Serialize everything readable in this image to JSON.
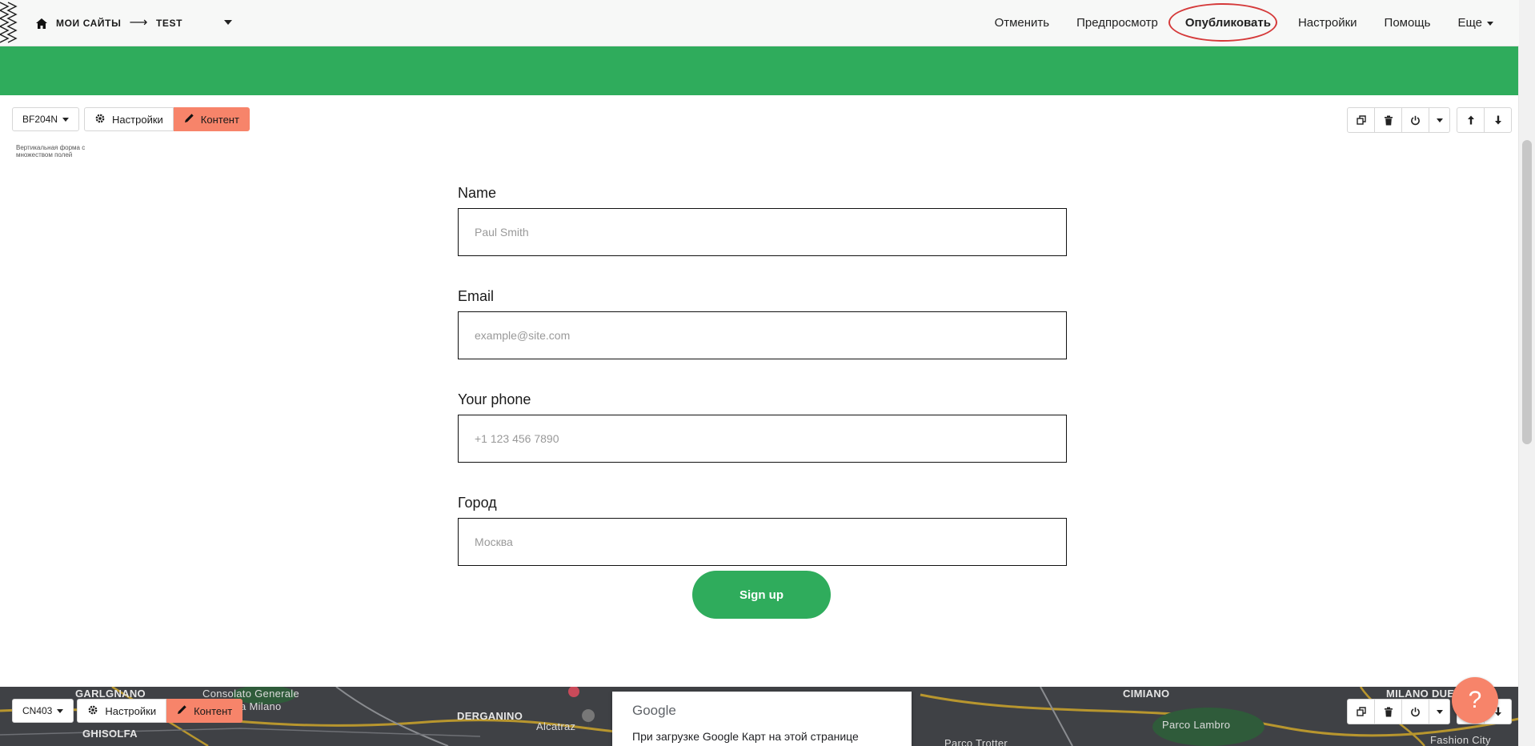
{
  "topbar": {
    "home_icon": "home-icon",
    "site_label": "МОИ САЙТЫ",
    "arrow": "⟶",
    "page_label": "TEST",
    "nav": [
      "Отменить",
      "Предпросмотр",
      "Опубликовать",
      "Настройки",
      "Помощь",
      "Еще"
    ]
  },
  "block1": {
    "id_label": "BF204N",
    "settings_label": "Настройки",
    "content_label": "Контент",
    "description": "Вертикальная форма с множеством полей",
    "tools": [
      "duplicate-icon",
      "trash-icon",
      "power-icon",
      "caret-down-icon",
      "arrow-up-icon",
      "arrow-down-icon"
    ]
  },
  "form": {
    "fields": [
      {
        "label": "Name",
        "placeholder": "Paul Smith"
      },
      {
        "label": "Email",
        "placeholder": "example@site.com"
      },
      {
        "label": "Your phone",
        "placeholder": "+1 123 456 7890"
      },
      {
        "label": "Город",
        "placeholder": "Москва"
      }
    ],
    "submit_label": "Sign up"
  },
  "block2": {
    "id_label": "CN403",
    "settings_label": "Настройки",
    "content_label": "Контент"
  },
  "map": {
    "labels": [
      "GARLGNANO",
      "Consolato Generale",
      "a Milano",
      "GHISOLFA",
      "DERGANINO",
      "Alcatraz",
      "CIMIANO",
      "MILANO DUE",
      "Parco Lambro",
      "Fashion City",
      "Parco Trotter"
    ],
    "panel_brand": "Google",
    "panel_text": "При загрузке Google Карт на этой странице"
  },
  "help": {
    "label": "?"
  },
  "colors": {
    "accent_green": "#2fac5c",
    "accent_salmon": "#f7846a",
    "publish_ring": "#d53a3a"
  }
}
